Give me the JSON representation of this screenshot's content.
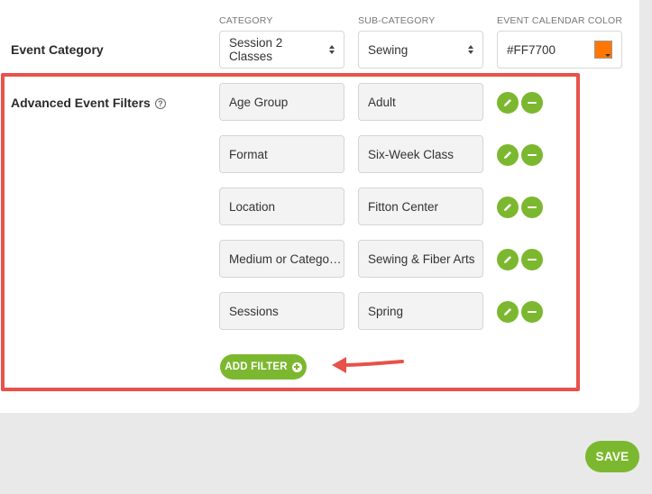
{
  "event_category": {
    "label": "Event Category",
    "headers": {
      "category": "CATEGORY",
      "sub_category": "SUB-CATEGORY",
      "color": "EVENT CALENDAR COLOR"
    },
    "category_value": "Session 2 Classes",
    "sub_category_value": "Sewing",
    "color_value": "#FF7700",
    "color_swatch": "#ff7700"
  },
  "advanced_filters": {
    "label": "Advanced Event Filters",
    "help_glyph": "?",
    "rows": [
      {
        "name": "Age Group",
        "value": "Adult"
      },
      {
        "name": "Format",
        "value": "Six-Week Class"
      },
      {
        "name": "Location",
        "value": "Fitton Center"
      },
      {
        "name": "Medium or Catego…",
        "value": "Sewing & Fiber Arts"
      },
      {
        "name": "Sessions",
        "value": "Spring"
      }
    ],
    "add_filter_label": "ADD FILTER"
  },
  "save_label": "SAVE",
  "colors": {
    "accent": "#7cb82f",
    "highlight": "#e8524a"
  },
  "icons": [
    "chevron-updown-icon",
    "dropdown-triangle-icon",
    "help-circle-icon",
    "pencil-icon",
    "minus-circle-icon",
    "plus-circle-icon",
    "arrow-left-icon"
  ]
}
